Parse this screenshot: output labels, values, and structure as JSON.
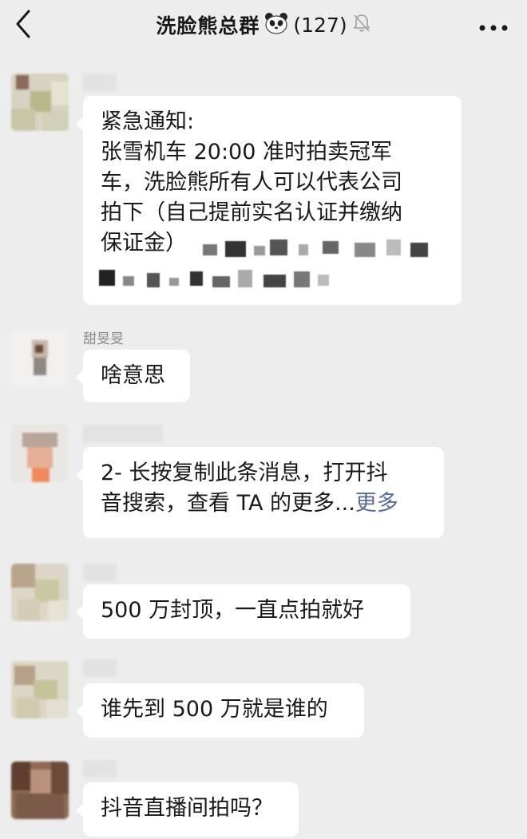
{
  "header": {
    "title": "洗脸熊总群",
    "count": "(127)"
  },
  "messages": [
    {
      "id": "m1",
      "lines": [
        "紧急通知:",
        "张雪机车 20:00 准时拍卖冠军",
        "车，洗脸熊所有人可以代表公司",
        "拍下（自己提前实名认证并缴纳",
        "保证金）"
      ]
    },
    {
      "id": "m2",
      "sender": "甜旻旻",
      "lines": [
        "啥意思"
      ]
    },
    {
      "id": "m3",
      "lines": [
        "2- 长按复制此条消息，打开抖",
        "音搜索，查看 TA 的更多..."
      ],
      "more_label": "更多"
    },
    {
      "id": "m4",
      "lines": [
        "500 万封顶，一直点拍就好"
      ]
    },
    {
      "id": "m5",
      "lines": [
        "谁先到 500 万就是谁的"
      ]
    },
    {
      "id": "m6",
      "lines": [
        "抖音直播间拍吗？"
      ]
    }
  ],
  "colors": {
    "background": "#ededed",
    "bubble": "#ffffff",
    "link": "#576b95",
    "sender_name": "#8a8a8a"
  },
  "icons": {
    "back": "chevron-left-icon",
    "panda": "panda-emoji-icon",
    "mute": "bell-muted-icon",
    "more": "more-dots-icon"
  }
}
